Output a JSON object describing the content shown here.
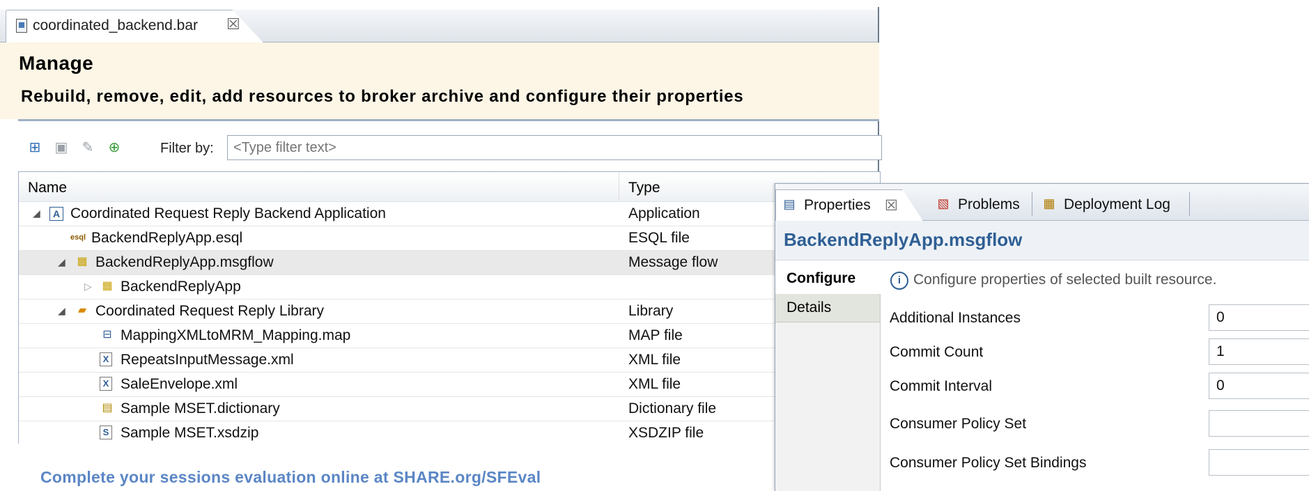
{
  "editor": {
    "tab_label": "coordinated_backend.bar",
    "title": "Manage",
    "description": "Rebuild, remove, edit, add resources to broker archive and configure their properties",
    "filter_label": "Filter by:",
    "filter_placeholder": "<Type filter text>",
    "columns": {
      "name": "Name",
      "type": "Type"
    },
    "rows": [
      {
        "name": "Coordinated Request Reply Backend Application",
        "type": "Application",
        "icon": "application-icon",
        "twisty": "expanded"
      },
      {
        "name": "BackendReplyApp.esql",
        "type": "ESQL file",
        "icon": "esql-file-icon",
        "twisty": "none"
      },
      {
        "name": "BackendReplyApp.msgflow",
        "type": "Message flow",
        "icon": "message-flow-icon",
        "twisty": "expanded",
        "selected": true
      },
      {
        "name": "BackendReplyApp",
        "type": "",
        "icon": "message-flow-icon",
        "twisty": "collapsed"
      },
      {
        "name": "Coordinated Request Reply Library",
        "type": "Library",
        "icon": "library-icon",
        "twisty": "expanded"
      },
      {
        "name": "MappingXMLtoMRM_Mapping.map",
        "type": "MAP file",
        "icon": "map-file-icon",
        "twisty": "none"
      },
      {
        "name": "RepeatsInputMessage.xml",
        "type": "XML file",
        "icon": "xml-file-icon",
        "twisty": "none"
      },
      {
        "name": "SaleEnvelope.xml",
        "type": "XML file",
        "icon": "xml-file-icon",
        "twisty": "none"
      },
      {
        "name": "Sample MSET.dictionary",
        "type": "Dictionary file",
        "icon": "dictionary-file-icon",
        "twisty": "none"
      },
      {
        "name": "Sample MSET.xsdzip",
        "type": "XSDZIP file",
        "icon": "xsdzip-file-icon",
        "twisty": "none"
      }
    ]
  },
  "footer": {
    "text": "Complete your sessions evaluation online at SHARE.org/SFEval"
  },
  "properties": {
    "tabs": [
      {
        "label": "Properties",
        "icon": "properties-icon"
      },
      {
        "label": "Problems",
        "icon": "problems-icon"
      },
      {
        "label": "Deployment Log",
        "icon": "deployment-log-icon"
      }
    ],
    "title": "BackendReplyApp.msgflow",
    "side_tabs": {
      "configure": "Configure",
      "details": "Details"
    },
    "info_text": "Configure properties of selected built resource.",
    "fields": [
      {
        "label": "Additional Instances",
        "value": "0"
      },
      {
        "label": "Commit Count",
        "value": "1"
      },
      {
        "label": "Commit Interval",
        "value": "0"
      },
      {
        "label": "Consumer Policy Set",
        "value": ""
      },
      {
        "label": "Consumer Policy Set Bindings",
        "value": ""
      }
    ]
  }
}
